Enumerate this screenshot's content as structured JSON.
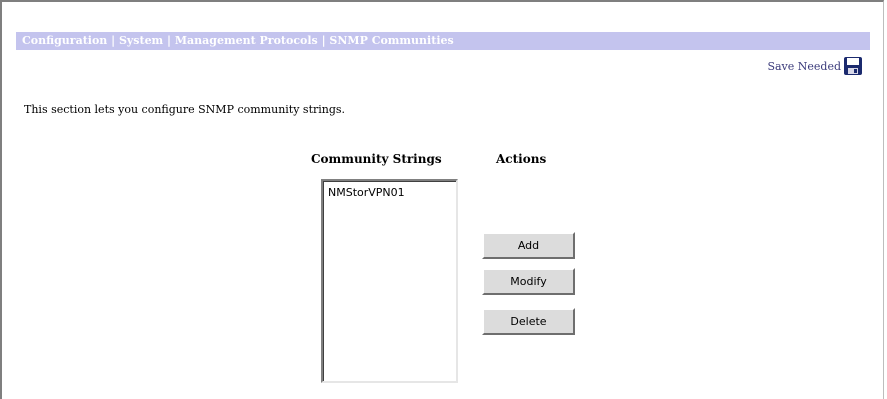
{
  "header": {
    "breadcrumb": "Configuration | System | Management Protocols | SNMP Communities"
  },
  "toolbar": {
    "save_label": "Save Needed",
    "save_icon": "floppy-disk-icon"
  },
  "intro_text": "This section lets you configure SNMP community strings.",
  "table": {
    "strings_header": "Community Strings",
    "actions_header": "Actions"
  },
  "community_strings": [
    "NMStorVPN01"
  ],
  "actions": {
    "add_label": "Add",
    "modify_label": "Modify",
    "delete_label": "Delete"
  },
  "colors": {
    "title_bar": "#c4c4ee",
    "link_text": "#3a3a7a",
    "button_face": "#dcdcdc"
  }
}
